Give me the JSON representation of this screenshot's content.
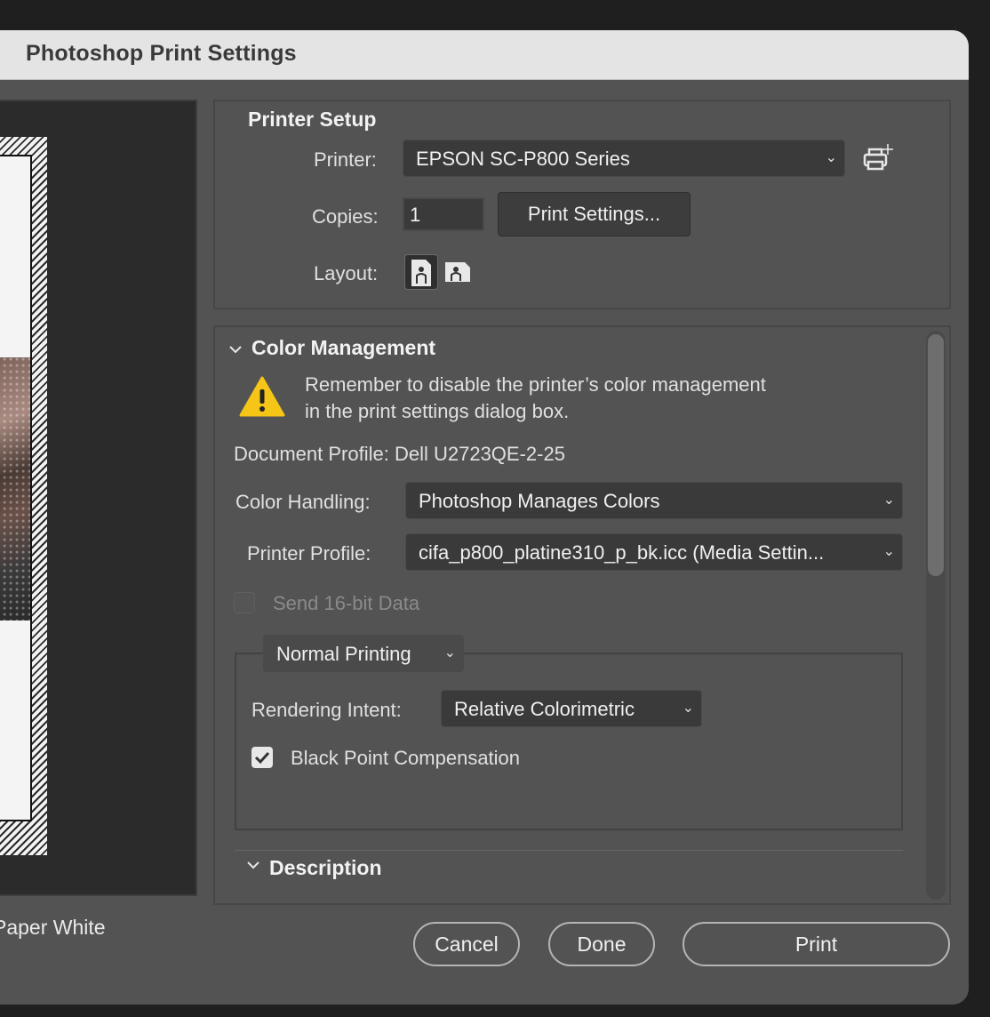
{
  "window": {
    "title": "Photoshop Print Settings"
  },
  "preview": {
    "paper_label": "Paper White"
  },
  "printer_setup": {
    "title": "Printer Setup",
    "printer_label": "Printer:",
    "printer_value": "EPSON SC-P800 Series",
    "copies_label": "Copies:",
    "copies_value": "1",
    "print_settings_button": "Print Settings...",
    "layout_label": "Layout:"
  },
  "color_management": {
    "title": "Color Management",
    "warning": "Remember to disable the printer’s color management in the print settings dialog box.",
    "document_profile": "Document Profile: Dell U2723QE-2-25",
    "color_handling_label": "Color Handling:",
    "color_handling_value": "Photoshop Manages Colors",
    "printer_profile_label": "Printer Profile:",
    "printer_profile_value": "cifa_p800_platine310_p_bk.icc (Media Settin...",
    "send16_label": "Send 16-bit Data",
    "send16_checked": false,
    "printing_mode_value": "Normal Printing",
    "rendering_intent_label": "Rendering Intent:",
    "rendering_intent_value": "Relative Colorimetric",
    "bpc_label": "Black Point Compensation",
    "bpc_checked": true
  },
  "description": {
    "title": "Description"
  },
  "buttons": {
    "cancel": "Cancel",
    "done": "Done",
    "print": "Print"
  }
}
